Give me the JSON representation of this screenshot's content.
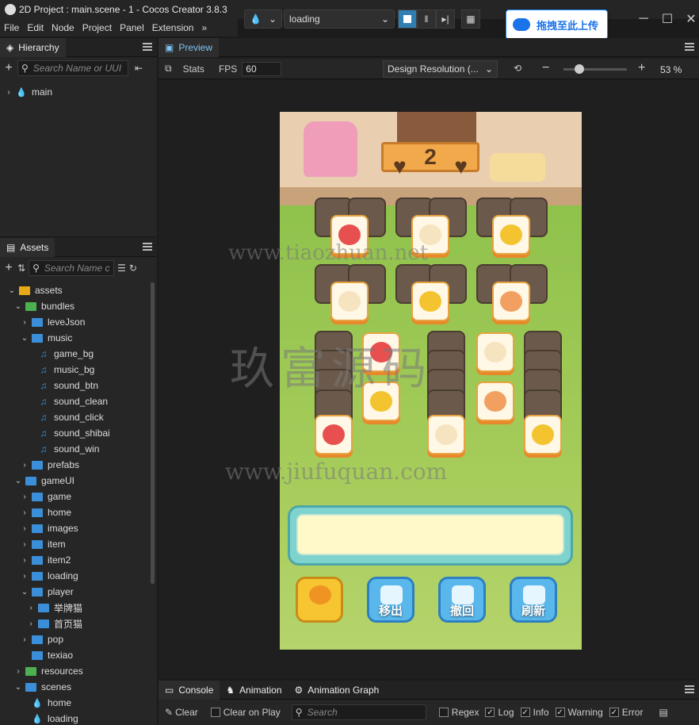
{
  "window": {
    "title": "2D Project : main.scene - 1 - Cocos Creator 3.8.3",
    "scene_select": "loading",
    "upload_label": "拖拽至此上传"
  },
  "menu": [
    "File",
    "Edit",
    "Node",
    "Project",
    "Panel",
    "Extension"
  ],
  "hierarchy": {
    "tab": "Hierarchy",
    "search_placeholder": "Search Name or UUI",
    "items": [
      {
        "label": "main"
      }
    ]
  },
  "assets": {
    "tab": "Assets",
    "search_placeholder": "Search Name c",
    "tree": [
      {
        "label": "assets",
        "type": "db",
        "level": 0,
        "open": true
      },
      {
        "label": "bundles",
        "type": "folder-green",
        "level": 1,
        "open": true
      },
      {
        "label": "leveJson",
        "type": "folder",
        "level": 2,
        "open": false
      },
      {
        "label": "music",
        "type": "folder",
        "level": 2,
        "open": true
      },
      {
        "label": "game_bg",
        "type": "music",
        "level": 3
      },
      {
        "label": "music_bg",
        "type": "music",
        "level": 3
      },
      {
        "label": "sound_btn",
        "type": "music",
        "level": 3
      },
      {
        "label": "sound_clean",
        "type": "music",
        "level": 3
      },
      {
        "label": "sound_click",
        "type": "music",
        "level": 3
      },
      {
        "label": "sound_shibai",
        "type": "music",
        "level": 3
      },
      {
        "label": "sound_win",
        "type": "music",
        "level": 3
      },
      {
        "label": "prefabs",
        "type": "folder",
        "level": 2,
        "open": false
      },
      {
        "label": "gameUI",
        "type": "folder",
        "level": 1,
        "open": true
      },
      {
        "label": "game",
        "type": "folder",
        "level": 2,
        "open": false
      },
      {
        "label": "home",
        "type": "folder",
        "level": 2,
        "open": false
      },
      {
        "label": "images",
        "type": "folder",
        "level": 2,
        "open": false
      },
      {
        "label": "item",
        "type": "folder",
        "level": 2,
        "open": false
      },
      {
        "label": "item2",
        "type": "folder",
        "level": 2,
        "open": false
      },
      {
        "label": "loading",
        "type": "folder",
        "level": 2,
        "open": false
      },
      {
        "label": "player",
        "type": "folder",
        "level": 2,
        "open": true
      },
      {
        "label": "举牌猫",
        "type": "folder",
        "level": 3,
        "open": false
      },
      {
        "label": "首页猫",
        "type": "folder",
        "level": 3,
        "open": false
      },
      {
        "label": "pop",
        "type": "folder",
        "level": 2,
        "open": false
      },
      {
        "label": "texiao",
        "type": "folder",
        "level": 2,
        "leaf": true
      },
      {
        "label": "resources",
        "type": "folder-green",
        "level": 1,
        "open": false
      },
      {
        "label": "scenes",
        "type": "folder",
        "level": 1,
        "open": true
      },
      {
        "label": "home",
        "type": "scene",
        "level": 2
      },
      {
        "label": "loading",
        "type": "scene",
        "level": 2
      }
    ]
  },
  "preview": {
    "tab": "Preview",
    "stats_label": "Stats",
    "fps_label": "FPS",
    "fps_value": "60",
    "design_resolution": "Design Resolution (...",
    "zoom": "53 %",
    "zoom_fraction": 0.25
  },
  "game": {
    "level": "2",
    "buttons": [
      "",
      "移出",
      "撤回",
      "刷新"
    ]
  },
  "watermarks": [
    "www.tiaozhuan.net",
    "玖富源码",
    "www.jiufuquan.com"
  ],
  "console": {
    "tabs": [
      "Console",
      "Animation",
      "Animation Graph"
    ],
    "clear": "Clear",
    "clear_on_play": "Clear on Play",
    "search_placeholder": "Search",
    "filters": [
      {
        "label": "Regex",
        "checked": false
      },
      {
        "label": "Log",
        "checked": true
      },
      {
        "label": "Info",
        "checked": true
      },
      {
        "label": "Warning",
        "checked": true
      },
      {
        "label": "Error",
        "checked": true
      }
    ]
  },
  "colors": {
    "accent": "#2f7fb3",
    "tray": "#7fd3cf",
    "grass": "#8fc24c"
  }
}
